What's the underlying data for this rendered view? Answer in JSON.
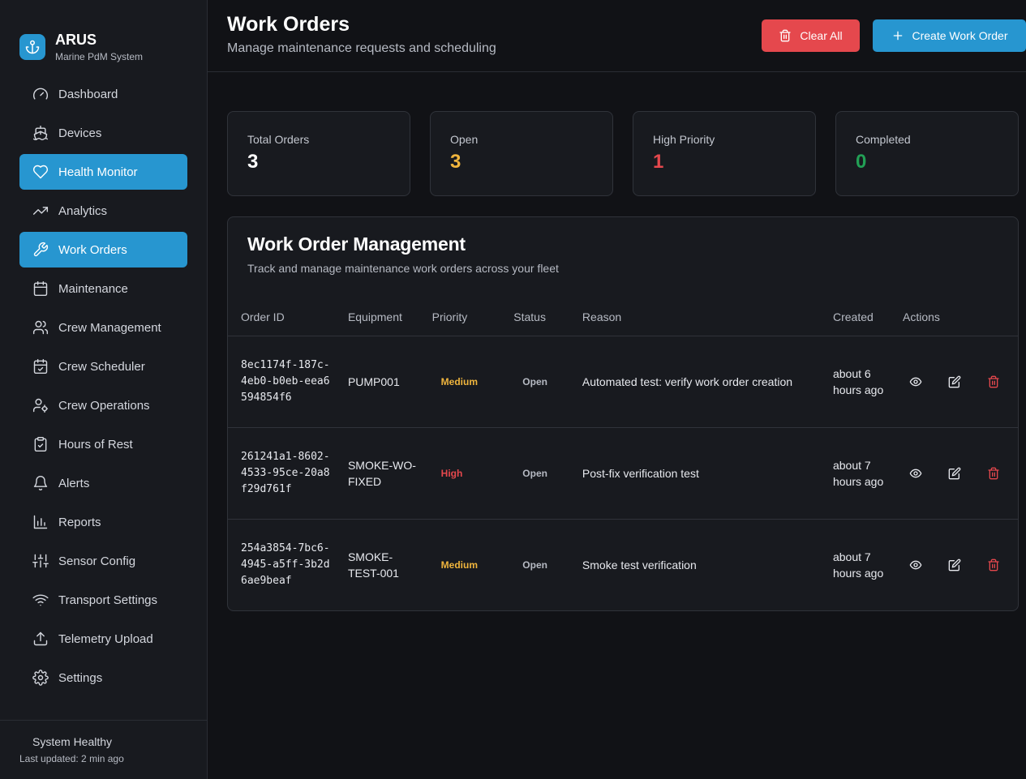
{
  "brand": {
    "title": "ARUS",
    "subtitle": "Marine PdM System"
  },
  "sidebar": {
    "items": [
      {
        "label": "Dashboard",
        "icon": "gauge-icon",
        "active": false
      },
      {
        "label": "Devices",
        "icon": "ship-icon",
        "active": false
      },
      {
        "label": "Health Monitor",
        "icon": "heart-icon",
        "active": true
      },
      {
        "label": "Analytics",
        "icon": "trending-up-icon",
        "active": false
      },
      {
        "label": "Work Orders",
        "icon": "wrench-icon",
        "active": true
      },
      {
        "label": "Maintenance",
        "icon": "calendar-icon",
        "active": false
      },
      {
        "label": "Crew Management",
        "icon": "users-icon",
        "active": false
      },
      {
        "label": "Crew Scheduler",
        "icon": "calendar-check-icon",
        "active": false
      },
      {
        "label": "Crew Operations",
        "icon": "user-cog-icon",
        "active": false
      },
      {
        "label": "Hours of Rest",
        "icon": "clipboard-check-icon",
        "active": false
      },
      {
        "label": "Alerts",
        "icon": "bell-icon",
        "active": false
      },
      {
        "label": "Reports",
        "icon": "bar-chart-icon",
        "active": false
      },
      {
        "label": "Sensor Config",
        "icon": "sliders-icon",
        "active": false
      },
      {
        "label": "Transport Settings",
        "icon": "wifi-icon",
        "active": false
      },
      {
        "label": "Telemetry Upload",
        "icon": "upload-icon",
        "active": false
      },
      {
        "label": "Settings",
        "icon": "gear-icon",
        "active": false
      }
    ],
    "footer": {
      "status": "System Healthy",
      "updated": "Last updated: 2 min ago"
    }
  },
  "header": {
    "title": "Work Orders",
    "subtitle": "Manage maintenance requests and scheduling",
    "clear_label": "Clear All",
    "create_label": "Create Work Order"
  },
  "stats": [
    {
      "label": "Total Orders",
      "value": "3",
      "color": "#ffffff"
    },
    {
      "label": "Open",
      "value": "3",
      "color": "#f0b53d"
    },
    {
      "label": "High Priority",
      "value": "1",
      "color": "#e5484d"
    },
    {
      "label": "Completed",
      "value": "0",
      "color": "#22a055"
    }
  ],
  "panel": {
    "title": "Work Order Management",
    "subtitle": "Track and manage maintenance work orders across your fleet"
  },
  "table": {
    "headers": [
      "Order ID",
      "Equipment",
      "Priority",
      "Status",
      "Reason",
      "Created",
      "Actions"
    ],
    "rows": [
      {
        "order_id": "8ec1174f-187c-4eb0-b0eb-eea6594854f6",
        "equipment": "PUMP001",
        "priority": "Medium",
        "status": "Open",
        "reason": "Automated test: verify work order creation",
        "created": "about 6 hours ago"
      },
      {
        "order_id": "261241a1-8602-4533-95ce-20a8f29d761f",
        "equipment": "SMOKE-WO-FIXED",
        "priority": "High",
        "status": "Open",
        "reason": "Post-fix verification test",
        "created": "about 7 hours ago"
      },
      {
        "order_id": "254a3854-7bc6-4945-a5ff-3b2d6ae9beaf",
        "equipment": "SMOKE-TEST-001",
        "priority": "Medium",
        "status": "Open",
        "reason": "Smoke test verification",
        "created": "about 7 hours ago"
      }
    ]
  },
  "colors": {
    "accent": "#2796d0",
    "danger": "#e5484d",
    "warning": "#f0b53d",
    "success": "#22a055"
  }
}
